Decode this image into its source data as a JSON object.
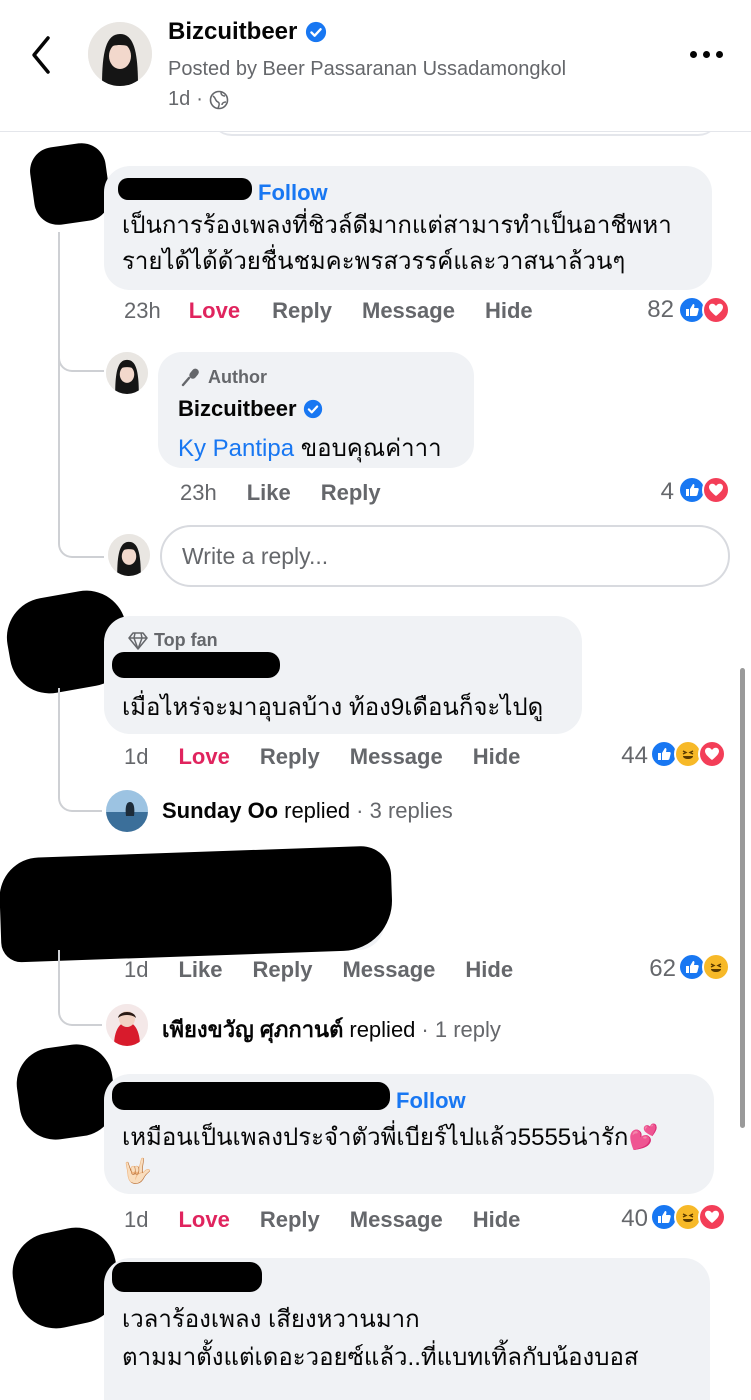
{
  "header": {
    "page_name": "Bizcuitbeer",
    "posted_by": "Posted by Beer Passaranan Ussadamongkol",
    "time": "1d",
    "separator": "·"
  },
  "comments": [
    {
      "author_blurred": true,
      "follow": "Follow",
      "text_line1": "เป็นการร้องเพลงที่ชิวล์ดีมากแต่สามารทำเป็นอาชีพหา",
      "text_line2": "รายได้ได้ด้วยชื่นชมคะพรสวรรค์และวาสนาล้วนๆ",
      "time": "23h",
      "actions": [
        "Love",
        "Reply",
        "Message",
        "Hide"
      ],
      "reaction_count": "82",
      "reactions": [
        "like-reaction",
        "love-reaction"
      ],
      "author_reply": {
        "badge": "Author",
        "name": "Bizcuitbeer",
        "mention": "Ky Pantipa",
        "text": "ขอบคุณค่าาา",
        "time": "23h",
        "actions": [
          "Like",
          "Reply"
        ],
        "reaction_count": "4",
        "reactions": [
          "like-reaction",
          "love-reaction"
        ]
      },
      "write_reply_placeholder": "Write a reply..."
    },
    {
      "badge": "Top fan",
      "author_blurred": true,
      "text": "เมื่อไหร่จะมาอุบลบ้าง ท้อง9เดือนก็จะไปดู",
      "time": "1d",
      "actions": [
        "Love",
        "Reply",
        "Message",
        "Hide"
      ],
      "reaction_count": "44",
      "reactions": [
        "like-reaction",
        "haha-reaction",
        "love-reaction"
      ],
      "replied": {
        "name": "Sunday Oo",
        "verb": "replied",
        "count": "· 3 replies"
      }
    },
    {
      "author_blurred": true,
      "time": "1d",
      "actions": [
        "Like",
        "Reply",
        "Message",
        "Hide"
      ],
      "reaction_count": "62",
      "reactions": [
        "like-reaction",
        "haha-reaction"
      ],
      "replied": {
        "name": "เพียงขวัญ ศุภกานต์",
        "verb": "replied",
        "count": "· 1 reply"
      }
    },
    {
      "author_blurred": true,
      "follow": "Follow",
      "text_line1": "เหมือนเป็นเพลงประจำตัวพี่เบียร์ไปแล้ว5555น่ารัก💕",
      "text_line2": "🤟🏻",
      "time": "1d",
      "actions": [
        "Love",
        "Reply",
        "Message",
        "Hide"
      ],
      "reaction_count": "40",
      "reactions": [
        "like-reaction",
        "haha-reaction",
        "love-reaction"
      ]
    },
    {
      "author_blurred": true,
      "text_line1": "เวลาร้องเพลง เสียงหวานมาก",
      "text_line2": "ตามมาตั้งแต่เดอะวอยซ์แล้ว..ที่แบทเทิ้ลกับน้องบอส"
    }
  ]
}
